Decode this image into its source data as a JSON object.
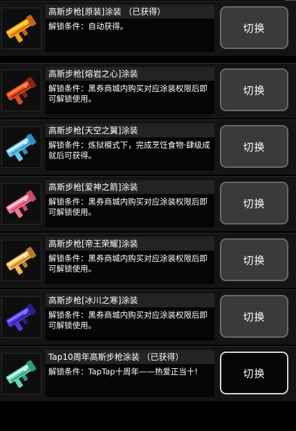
{
  "skins": [
    {
      "title": "高斯步枪[原装]涂装 （已获得）",
      "condition": "解锁条件：自动获得。",
      "button": "切换",
      "icon": "orange-gauss-rifle-icon",
      "colors": {
        "main": "#f6a21a",
        "light": "#ffd34d",
        "dark": "#c8641a"
      }
    },
    {
      "title": "高斯步枪[熔岩之心]涂装",
      "condition": "解锁条件：黑券商城内购买对应涂装权限后即可解锁使用。",
      "button": "切换",
      "icon": "lava-gauss-rifle-icon",
      "colors": {
        "main": "#e04a28",
        "light": "#ff8a3a",
        "dark": "#8a2514"
      }
    },
    {
      "title": "高斯步枪[天空之翼]涂装",
      "condition": "解锁条件：炼狱模式下，完成烹饪食物·肆级成就后可获得。",
      "button": "切换",
      "icon": "sky-gauss-rifle-icon",
      "colors": {
        "main": "#68c6ec",
        "light": "#d8f2ff",
        "dark": "#2f8fc6"
      }
    },
    {
      "title": "高斯步枪[爱神之箭]涂装",
      "condition": "解锁条件：黑券商城内购买对应涂装权限后即可解锁使用。",
      "button": "切换",
      "icon": "cupid-gauss-rifle-icon",
      "colors": {
        "main": "#f07890",
        "light": "#ffd0dc",
        "dark": "#c84a68"
      }
    },
    {
      "title": "高斯步枪[帝王荣耀]涂装",
      "condition": "解锁条件：黑券商城内购买对应涂装权限后即可解锁使用。",
      "button": "切换",
      "icon": "royal-gauss-rifle-icon",
      "colors": {
        "main": "#f5b64a",
        "light": "#fff0c0",
        "dark": "#b87a28"
      }
    },
    {
      "title": "高斯步枪[冰川之寒]涂装",
      "condition": "解锁条件：黑券商城内购买对应涂装权限后即可解锁使用。",
      "button": "切换",
      "icon": "glacier-gauss-rifle-icon",
      "colors": {
        "main": "#4a3ce0",
        "light": "#8a7cff",
        "dark": "#2a1a8a"
      }
    },
    {
      "title": "Tap10周年高斯步枪涂装 （已获得）",
      "condition": "解锁条件：TapTap十周年——热爱正当十!",
      "button": "切换",
      "icon": "tap10-gauss-rifle-icon",
      "active": true,
      "colors": {
        "main": "#62d8b4",
        "light": "#d8fff0",
        "dark": "#2f9a80"
      }
    }
  ]
}
